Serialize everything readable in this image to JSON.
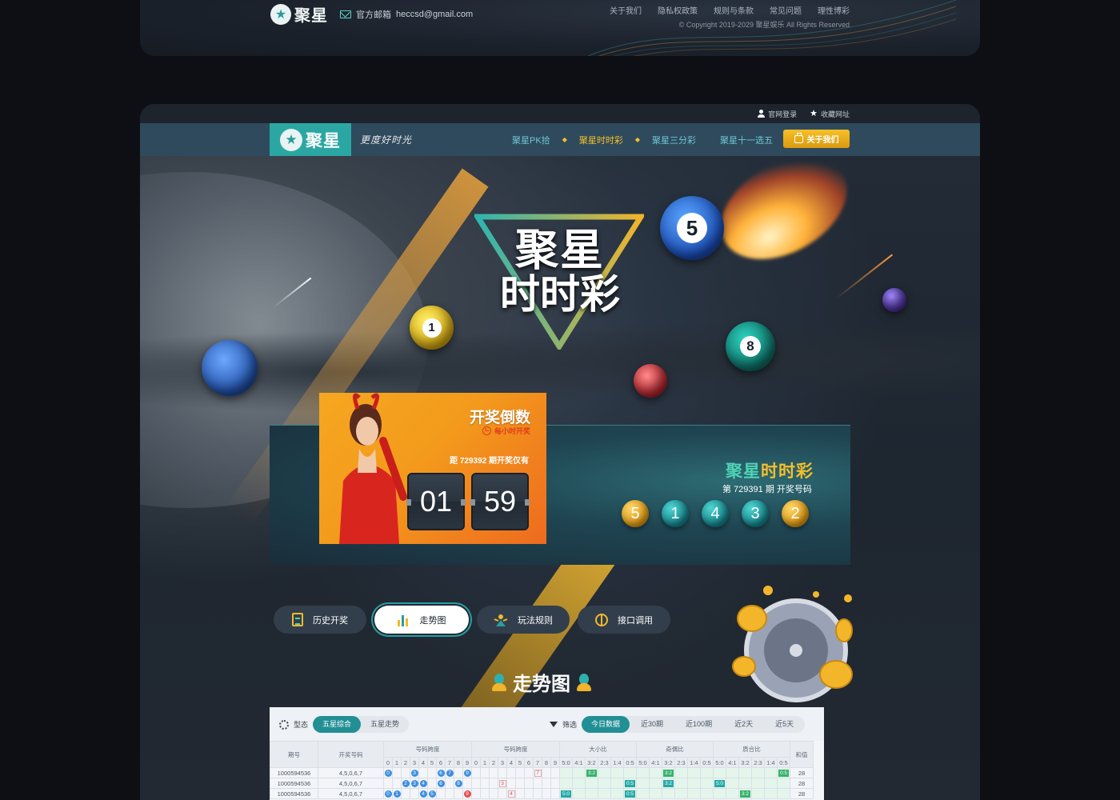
{
  "footer": {
    "logo_text": "聚星",
    "email_label": "官方邮箱",
    "email": "heccsd@gmail.com",
    "links": [
      "关于我们",
      "隐私权政策",
      "规则与条款",
      "常见问题",
      "理性博彩"
    ],
    "copyright": "© Copyright 2019-2029 聚星娱乐 All Rights Reserved"
  },
  "topbar": {
    "login": "官网登录",
    "bookmark": "收藏网址"
  },
  "nav": {
    "logo_text": "聚星",
    "slogan": "更度好时光",
    "items": [
      {
        "label": "聚星PK拾",
        "active": false
      },
      {
        "label": "聚星时时彩",
        "active": true
      },
      {
        "label": "聚星三分彩",
        "active": false
      },
      {
        "label": "聚星十一选五",
        "active": false
      }
    ],
    "about": "关于我们"
  },
  "hero": {
    "title_line1": "聚星",
    "title_line2": "时时彩",
    "ball_numbers": [
      "5",
      "1",
      "8"
    ]
  },
  "countdown": {
    "title": "开奖倒数",
    "subtitle": "每小时开奖",
    "issue_text": "距 729392 期开奖仅有",
    "minutes": "01",
    "seconds": "59"
  },
  "result": {
    "title_a": "聚星",
    "title_b": "时时彩",
    "issue_text": "第 729391 期 开奖号码",
    "numbers": [
      {
        "value": "5",
        "style": "gold"
      },
      {
        "value": "1",
        "style": "teal"
      },
      {
        "value": "4",
        "style": "teal"
      },
      {
        "value": "3",
        "style": "teal"
      },
      {
        "value": "2",
        "style": "gold"
      }
    ]
  },
  "tabs": [
    {
      "label": "历史开奖",
      "icon": "history-icon",
      "active": false
    },
    {
      "label": "走势图",
      "icon": "chart-icon",
      "active": true
    },
    {
      "label": "玩法规则",
      "icon": "rules-icon",
      "active": false
    },
    {
      "label": "接口调用",
      "icon": "api-icon",
      "active": false
    }
  ],
  "trend": {
    "heading": "走势图",
    "form_label": "型态",
    "form_options": [
      {
        "label": "五星综合",
        "on": true
      },
      {
        "label": "五星走势",
        "on": false
      }
    ],
    "filter_label": "筛选",
    "filter_options": [
      {
        "label": "今日数据",
        "on": true
      },
      {
        "label": "近30期",
        "on": false
      },
      {
        "label": "近100期",
        "on": false
      },
      {
        "label": "近2天",
        "on": false
      },
      {
        "label": "近5天",
        "on": false
      }
    ],
    "headers": {
      "issue": "期号",
      "code": "开奖号码",
      "span1": "号码跨度",
      "span2": "号码跨度",
      "size": "大小比",
      "parity": "奇偶比",
      "prime": "质合比",
      "sum": "和值"
    },
    "digits": [
      "0",
      "1",
      "2",
      "3",
      "4",
      "5",
      "6",
      "7",
      "8",
      "9"
    ],
    "ratios": [
      "5:0",
      "4:1",
      "3:2",
      "2:3",
      "1:4",
      "0:5"
    ],
    "rows": [
      {
        "issue": "1000594536",
        "code": "4,5,0,6,7",
        "sum": "28"
      },
      {
        "issue": "1000594536",
        "code": "4,5,0,6,7",
        "sum": "28"
      },
      {
        "issue": "1000594536",
        "code": "4,5,0,6,7",
        "sum": "28"
      }
    ]
  }
}
